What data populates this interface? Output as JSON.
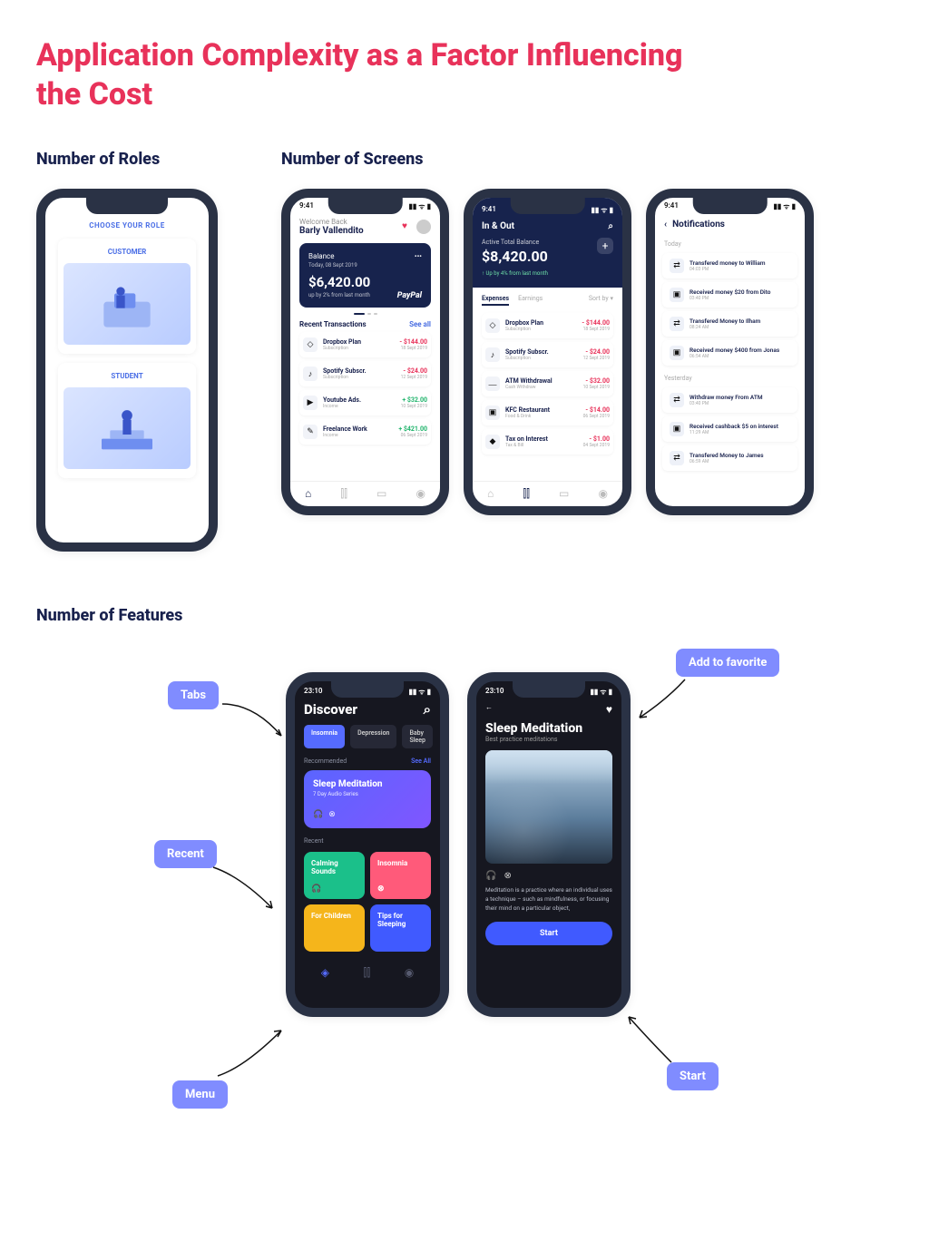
{
  "title": "Application Complexity as a Factor Influencing the Cost",
  "sections": {
    "roles": "Number of Roles",
    "screens": "Number of Screens",
    "features": "Number of Features"
  },
  "rolesPhone": {
    "heading": "CHOOSE YOUR ROLE",
    "role1": "CUSTOMER",
    "role2": "STUDENT"
  },
  "screensPhones": {
    "balance": {
      "time": "9:41",
      "welcome": "Welcome Back",
      "user": "Barly Vallendito",
      "card": {
        "label": "Balance",
        "date": "Today, 08 Sept 2019",
        "amount": "$6,420.00",
        "sub": "up by 2% from last month",
        "brand": "PayPal"
      },
      "transHead": "Recent Transactions",
      "seeAll": "See all",
      "items": [
        {
          "icon": "◇",
          "name": "Dropbox Plan",
          "sub": "Subscription",
          "amount": "- $144.00",
          "cls": "neg",
          "date": "18 Sept 2019"
        },
        {
          "icon": "♪",
          "name": "Spotify Subscr.",
          "sub": "Subscription",
          "amount": "- $24.00",
          "cls": "neg",
          "date": "12 Sept 2019"
        },
        {
          "icon": "▶",
          "name": "Youtube Ads.",
          "sub": "Income",
          "amount": "+ $32.00",
          "cls": "pos",
          "date": "10 Sept 2019"
        },
        {
          "icon": "✎",
          "name": "Freelance Work",
          "sub": "Income",
          "amount": "+ $421.00",
          "cls": "pos",
          "date": "06 Sept 2019"
        }
      ]
    },
    "inout": {
      "time": "9:41",
      "title": "In & Out",
      "label": "Active Total Balance",
      "amount": "$8,420.00",
      "sub": "↑  Up by 4% from last month",
      "tabExp": "Expenses",
      "tabEarn": "Earnings",
      "sort": "Sort by ▾",
      "items": [
        {
          "icon": "◇",
          "name": "Dropbox Plan",
          "sub": "Subscription",
          "amount": "- $144.00",
          "date": "18 Sept 2019"
        },
        {
          "icon": "♪",
          "name": "Spotify Subscr.",
          "sub": "Subscription",
          "amount": "- $24.00",
          "date": "12 Sept 2019"
        },
        {
          "icon": "⎼",
          "name": "ATM Withdrawal",
          "sub": "Cash Withdraw",
          "amount": "- $32.00",
          "date": "10 Sept 2019"
        },
        {
          "icon": "▣",
          "name": "KFC Restaurant",
          "sub": "Food & Drink",
          "amount": "- $14.00",
          "date": "06 Sept 2019"
        },
        {
          "icon": "◆",
          "name": "Tax on Interest",
          "sub": "Tax & Bill",
          "amount": "- $1.00",
          "date": "04 Sept 2019"
        }
      ]
    },
    "notif": {
      "time": "9:41",
      "title": "Notifications",
      "today": "Today",
      "yesterday": "Yesterday",
      "todayItems": [
        {
          "icon": "⇄",
          "txt": "Transfered money to William",
          "time": "04:03 PM"
        },
        {
          "icon": "▣",
          "txt": "Received money $20 from Dito",
          "amtColor": "pos",
          "time": "03:40 PM"
        },
        {
          "icon": "⇄",
          "txt": "Transfered Money to Ilham",
          "time": "08:24 AM"
        },
        {
          "icon": "▣",
          "txt": "Received money $400 from Jonas",
          "time": "06:54 AM"
        }
      ],
      "ydayItems": [
        {
          "icon": "⇄",
          "txt": "Withdraw money From ATM",
          "time": "03:40 PM"
        },
        {
          "icon": "▣",
          "txt": "Received cashback $5 on interest",
          "time": "11:29 AM"
        },
        {
          "icon": "⇄",
          "txt": "Transfered Money to James",
          "time": "06:59 AM"
        }
      ]
    }
  },
  "features": {
    "callouts": {
      "tabs": "Tabs",
      "recent": "Recent",
      "menu": "Menu",
      "favorite": "Add to favorite",
      "start": "Start"
    },
    "discover": {
      "time": "23:10",
      "title": "Discover",
      "chips": [
        "Insomnia",
        "Depression",
        "Baby Sleep"
      ],
      "recLabel": "Recommended",
      "seeAll": "See All",
      "bigCard": {
        "title": "Sleep Meditation",
        "sub": "7 Day Audio Series"
      },
      "recentLabel": "Recent",
      "tiles": [
        "Calming Sounds",
        "Insomnia",
        "For Children",
        "Tips for Sleeping"
      ]
    },
    "detail": {
      "time": "23:10",
      "title": "Sleep Meditation",
      "sub": "Best practice meditations",
      "desc": "Meditation is a practice where an individual uses a technique – such as mindfulness, or focusing their mind on a particular object,",
      "btn": "Start"
    }
  }
}
